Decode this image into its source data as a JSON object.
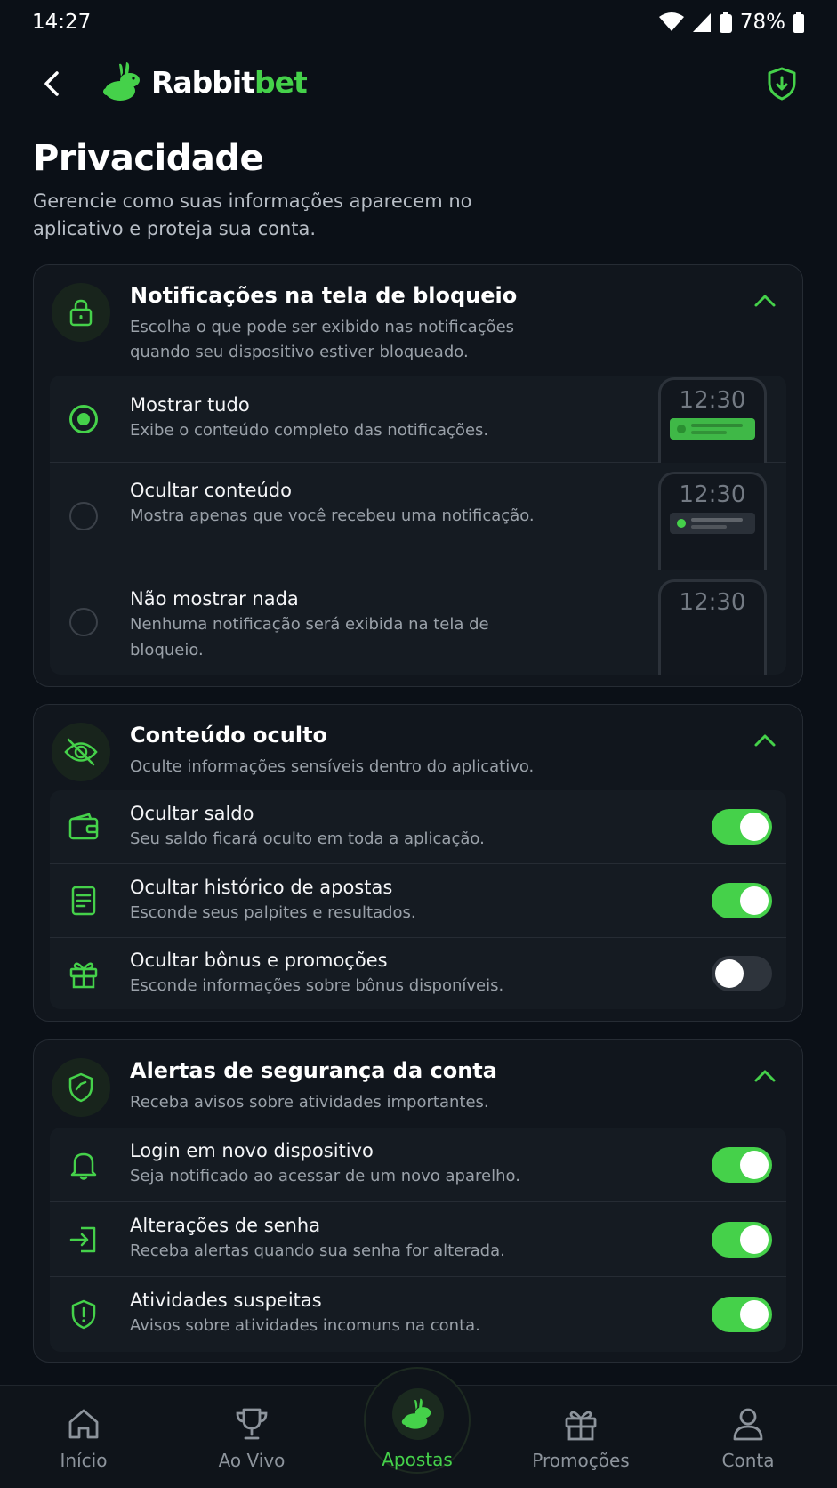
{
  "status_bar": {
    "time": "14:27",
    "battery": "78%"
  },
  "header": {
    "brand_white": "Rabbit",
    "brand_green": "bet",
    "icons": [
      "back-arrow-icon",
      "rabbit-logo-icon",
      "shield-download-icon"
    ]
  },
  "page": {
    "title": "Privacidade",
    "subtitle": "Gerencie como suas informações aparecem no aplicativo e proteja sua conta."
  },
  "lock_notifications": {
    "title": "Notificações na tela de bloqueio",
    "description": "Escolha o que pode ser exibido nas notificações quando seu dispositivo estiver bloqueado.",
    "selected": "Mostrar tudo",
    "options": [
      {
        "title": "Mostrar tudo",
        "description": "Exibe o conteúdo completo das notificações.",
        "preview_time": "12:30",
        "selected": true
      },
      {
        "title": "Ocultar conteúdo",
        "description": "Mostra apenas que você recebeu uma notificação.",
        "preview_time": "12:30",
        "selected": false
      },
      {
        "title": "Não mostrar nada",
        "description": "Nenhuma notificação será exibida na tela de bloqueio.",
        "preview_time": "12:30",
        "selected": false
      }
    ]
  },
  "hidden_content": {
    "title": "Conteúdo oculto",
    "description": "Oculte informações sensíveis dentro do aplicativo.",
    "items": [
      {
        "title": "Ocultar saldo",
        "description": "Seu saldo ficará oculto em toda a aplicação.",
        "icon": "wallet-icon",
        "enabled": true
      },
      {
        "title": "Ocultar histórico de apostas",
        "description": "Esconde seus palpites e resultados.",
        "icon": "receipt-icon",
        "enabled": true
      },
      {
        "title": "Ocultar bônus e promoções",
        "description": "Esconde informações sobre bônus disponíveis.",
        "icon": "gift-icon",
        "enabled": false
      }
    ]
  },
  "security_alerts": {
    "title": "Alertas de segurança da conta",
    "description": "Receba avisos sobre atividades importantes.",
    "items": [
      {
        "title": "Login em novo dispositivo",
        "description": "Seja notificado ao acessar de um novo aparelho.",
        "icon": "bell-icon",
        "enabled": true
      },
      {
        "title": "Alterações de senha",
        "description": "Receba alertas quando sua senha for alterada.",
        "icon": "login-arrow-icon",
        "enabled": true
      },
      {
        "title": "Atividades suspeitas",
        "description": "Avisos sobre atividades incomuns na conta.",
        "icon": "shield-alert-icon",
        "enabled": true
      }
    ]
  },
  "bottom_nav": {
    "active": "Apostas",
    "items": [
      {
        "label": "Início",
        "icon": "home-icon"
      },
      {
        "label": "Ao Vivo",
        "icon": "trophy-icon"
      },
      {
        "label": "Apostas",
        "icon": "rabbit-icon"
      },
      {
        "label": "Promoções",
        "icon": "gift-icon"
      },
      {
        "label": "Conta",
        "icon": "user-icon"
      }
    ]
  },
  "colors": {
    "accent": "#45d14a",
    "background": "#0b1017",
    "card": "#11161d"
  }
}
